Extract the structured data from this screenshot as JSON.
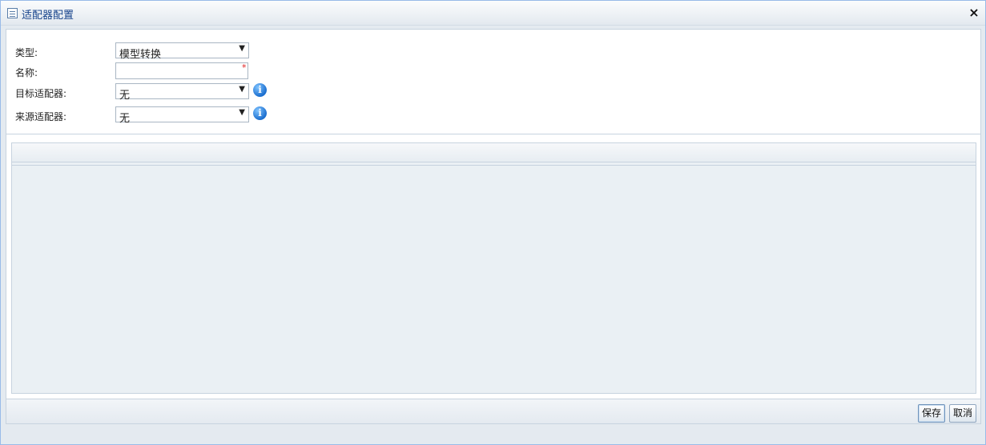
{
  "window": {
    "title": "适配器配置",
    "icon": "table-icon",
    "close_icon": "close-icon",
    "close_glyph": "×"
  },
  "form": {
    "type": {
      "label": "类型:",
      "value": "模型转换"
    },
    "name": {
      "label": "名称:",
      "value": "",
      "required_mark": "*"
    },
    "target_adapter": {
      "label": "目标适配器:",
      "value": "无",
      "info_glyph": "i"
    },
    "source_adapter": {
      "label": "来源适配器:",
      "value": "无",
      "info_glyph": "i"
    },
    "dropdown_arrow": "▼"
  },
  "footer": {
    "save_label": "保存",
    "cancel_label": "取消"
  },
  "colors": {
    "title_text": "#15428b",
    "required": "#e02020",
    "info_icon": "#1c6fcf"
  }
}
